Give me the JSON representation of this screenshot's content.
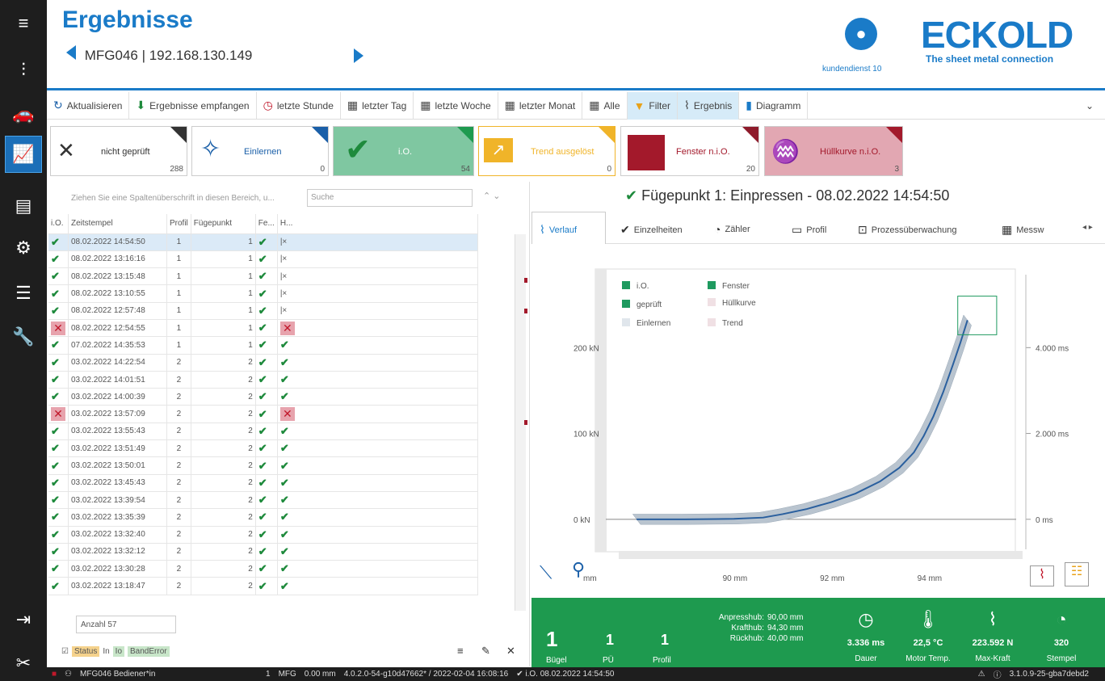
{
  "header": {
    "title": "Ergebnisse",
    "device": "MFG046 | 192.168.130.149",
    "user": "kundendienst 10",
    "logo": "ECKOLD",
    "slogan": "The sheet metal connection"
  },
  "toolbar": [
    {
      "label": "Aktualisieren",
      "icon": "refresh-icon"
    },
    {
      "label": "Ergebnisse empfangen",
      "icon": "download-icon"
    },
    {
      "label": "letzte Stunde",
      "icon": "clock-icon"
    },
    {
      "label": "letzter Tag",
      "icon": "calendar-icon"
    },
    {
      "label": "letzte Woche",
      "icon": "calendar-icon"
    },
    {
      "label": "letzter Monat",
      "icon": "calendar-icon"
    },
    {
      "label": "Alle",
      "icon": "calendar-icon"
    },
    {
      "label": "Filter",
      "icon": "filter-icon"
    },
    {
      "label": "Ergebnis",
      "icon": "chart-line-icon"
    },
    {
      "label": "Diagramm",
      "icon": "bar-chart-icon"
    }
  ],
  "tiles": [
    {
      "label": "nicht geprüft",
      "count": "288"
    },
    {
      "label": "Einlernen",
      "count": "0"
    },
    {
      "label": "i.O.",
      "count": "54"
    },
    {
      "label": "Trend ausgelöst",
      "count": "0"
    },
    {
      "label": "Fenster n.i.O.",
      "count": "20"
    },
    {
      "label": "Hüllkurve n.i.O.",
      "count": "3"
    }
  ],
  "grid": {
    "group_hint": "Ziehen Sie eine Spaltenüberschrift in diesen Bereich, u...",
    "search_placeholder": "Suche",
    "headers": [
      "i.O.",
      "Zeitstempel",
      "Profil",
      "Fügepunkt",
      "Fe...",
      "H..."
    ],
    "rows": [
      {
        "ok": true,
        "ts": "08.02.2022 14:54:50",
        "profil": "1",
        "fp": "1",
        "fe": true,
        "h": "skip"
      },
      {
        "ok": true,
        "ts": "08.02.2022 13:16:16",
        "profil": "1",
        "fp": "1",
        "fe": true,
        "h": "skip"
      },
      {
        "ok": true,
        "ts": "08.02.2022 13:15:48",
        "profil": "1",
        "fp": "1",
        "fe": true,
        "h": "skip"
      },
      {
        "ok": true,
        "ts": "08.02.2022 13:10:55",
        "profil": "1",
        "fp": "1",
        "fe": true,
        "h": "skip"
      },
      {
        "ok": true,
        "ts": "08.02.2022 12:57:48",
        "profil": "1",
        "fp": "1",
        "fe": true,
        "h": "skip"
      },
      {
        "ok": false,
        "ts": "08.02.2022 12:54:55",
        "profil": "1",
        "fp": "1",
        "fe": true,
        "h": "nok"
      },
      {
        "ok": true,
        "ts": "07.02.2022 14:35:53",
        "profil": "1",
        "fp": "1",
        "fe": true,
        "h": "ok"
      },
      {
        "ok": true,
        "ts": "03.02.2022 14:22:54",
        "profil": "2",
        "fp": "2",
        "fe": true,
        "h": "ok"
      },
      {
        "ok": true,
        "ts": "03.02.2022 14:01:51",
        "profil": "2",
        "fp": "2",
        "fe": true,
        "h": "ok"
      },
      {
        "ok": true,
        "ts": "03.02.2022 14:00:39",
        "profil": "2",
        "fp": "2",
        "fe": true,
        "h": "ok"
      },
      {
        "ok": false,
        "ts": "03.02.2022 13:57:09",
        "profil": "2",
        "fp": "2",
        "fe": true,
        "h": "nok"
      },
      {
        "ok": true,
        "ts": "03.02.2022 13:55:43",
        "profil": "2",
        "fp": "2",
        "fe": true,
        "h": "ok"
      },
      {
        "ok": true,
        "ts": "03.02.2022 13:51:49",
        "profil": "2",
        "fp": "2",
        "fe": true,
        "h": "ok"
      },
      {
        "ok": true,
        "ts": "03.02.2022 13:50:01",
        "profil": "2",
        "fp": "2",
        "fe": true,
        "h": "ok"
      },
      {
        "ok": true,
        "ts": "03.02.2022 13:45:43",
        "profil": "2",
        "fp": "2",
        "fe": true,
        "h": "ok"
      },
      {
        "ok": true,
        "ts": "03.02.2022 13:39:54",
        "profil": "2",
        "fp": "2",
        "fe": true,
        "h": "ok"
      },
      {
        "ok": true,
        "ts": "03.02.2022 13:35:39",
        "profil": "2",
        "fp": "2",
        "fe": true,
        "h": "ok"
      },
      {
        "ok": true,
        "ts": "03.02.2022 13:32:40",
        "profil": "2",
        "fp": "2",
        "fe": true,
        "h": "ok"
      },
      {
        "ok": true,
        "ts": "03.02.2022 13:32:12",
        "profil": "2",
        "fp": "2",
        "fe": true,
        "h": "ok"
      },
      {
        "ok": true,
        "ts": "03.02.2022 13:30:28",
        "profil": "2",
        "fp": "2",
        "fe": true,
        "h": "ok"
      },
      {
        "ok": true,
        "ts": "03.02.2022 13:18:47",
        "profil": "2",
        "fp": "2",
        "fe": true,
        "h": "ok"
      }
    ],
    "count_label": "Anzahl 57",
    "filter_status": "Status",
    "filter_in": "In",
    "filter_io": "Io",
    "filter_band": "BandError"
  },
  "detail": {
    "title": "Fügepunkt 1: Einpressen - 08.02.2022 14:54:50",
    "tabs": [
      "Verlauf",
      "Einzelheiten",
      "Zähler",
      "Profil",
      "Prozessüberwachung",
      "Messw"
    ]
  },
  "chart_data": {
    "type": "line",
    "legend": [
      "i.O.",
      "Fenster",
      "geprüft",
      "Hüllkurve",
      "Einlernen",
      "Trend"
    ],
    "legend_colors": [
      "#1e9a5f",
      "#1e9a5f",
      "#1e9a5f",
      "#f0e0e4",
      "#e0e6ec",
      "#f0e0e4"
    ],
    "xlabel": "mm",
    "x_ticks": [
      "90 mm",
      "92 mm",
      "94 mm"
    ],
    "y_left_ticks": [
      "0 kN",
      "100 kN",
      "200 kN"
    ],
    "y_right_ticks": [
      "0 ms",
      "2.000 ms",
      "4.000 ms"
    ],
    "x_range": [
      87.5,
      95.8
    ],
    "y_range": [
      -35,
      285
    ],
    "series": [
      {
        "values": [
          [
            88.0,
            0
          ],
          [
            89.0,
            0
          ],
          [
            90.0,
            0.5
          ],
          [
            90.6,
            2
          ],
          [
            91.0,
            6
          ],
          [
            91.5,
            12
          ],
          [
            92.0,
            20
          ],
          [
            92.5,
            30
          ],
          [
            93.0,
            44
          ],
          [
            93.4,
            60
          ],
          [
            93.7,
            78
          ],
          [
            93.9,
            97
          ],
          [
            94.1,
            120
          ],
          [
            94.3,
            148
          ],
          [
            94.5,
            180
          ],
          [
            94.65,
            205
          ],
          [
            94.8,
            232
          ]
        ]
      }
    ],
    "window_box": {
      "x": [
        94.6,
        95.4
      ],
      "y": [
        215,
        260
      ]
    },
    "colors": {
      "line": "#2a5f9e",
      "band": "#b9c4cf",
      "window": "#1e9a5f"
    }
  },
  "bottom": {
    "buegel": "1",
    "buegel_label": "Bügel",
    "pue": "1",
    "pue_label": "PÜ",
    "profil": "1",
    "profil_label": "Profil",
    "anpress_l": "Anpresshub:",
    "anpress_v": "90,00 mm",
    "kraft_l": "Krafthub:",
    "kraft_v": "94,30 mm",
    "rueck_l": "Rückhub:",
    "rueck_v": "40,00 mm",
    "dauer": "3.336 ms",
    "dauer_label": "Dauer",
    "temp": "22,5 °C",
    "temp_label": "Motor Temp.",
    "kraft": "223.592 N",
    "kraft_label": "Max-Kraft",
    "stempel": "320",
    "stempel_label": "Stempel"
  },
  "status": {
    "user": "MFG046 Bediener*in",
    "num": "1",
    "mfg": "MFG",
    "pos": "0.00 mm",
    "version": "4.0.2.0-54-g10d47662* / 2022-02-04 16:08:16",
    "last": "i.O. 08.02.2022 14:54:50",
    "build": "3.1.0.9-25-gba7debd2"
  }
}
